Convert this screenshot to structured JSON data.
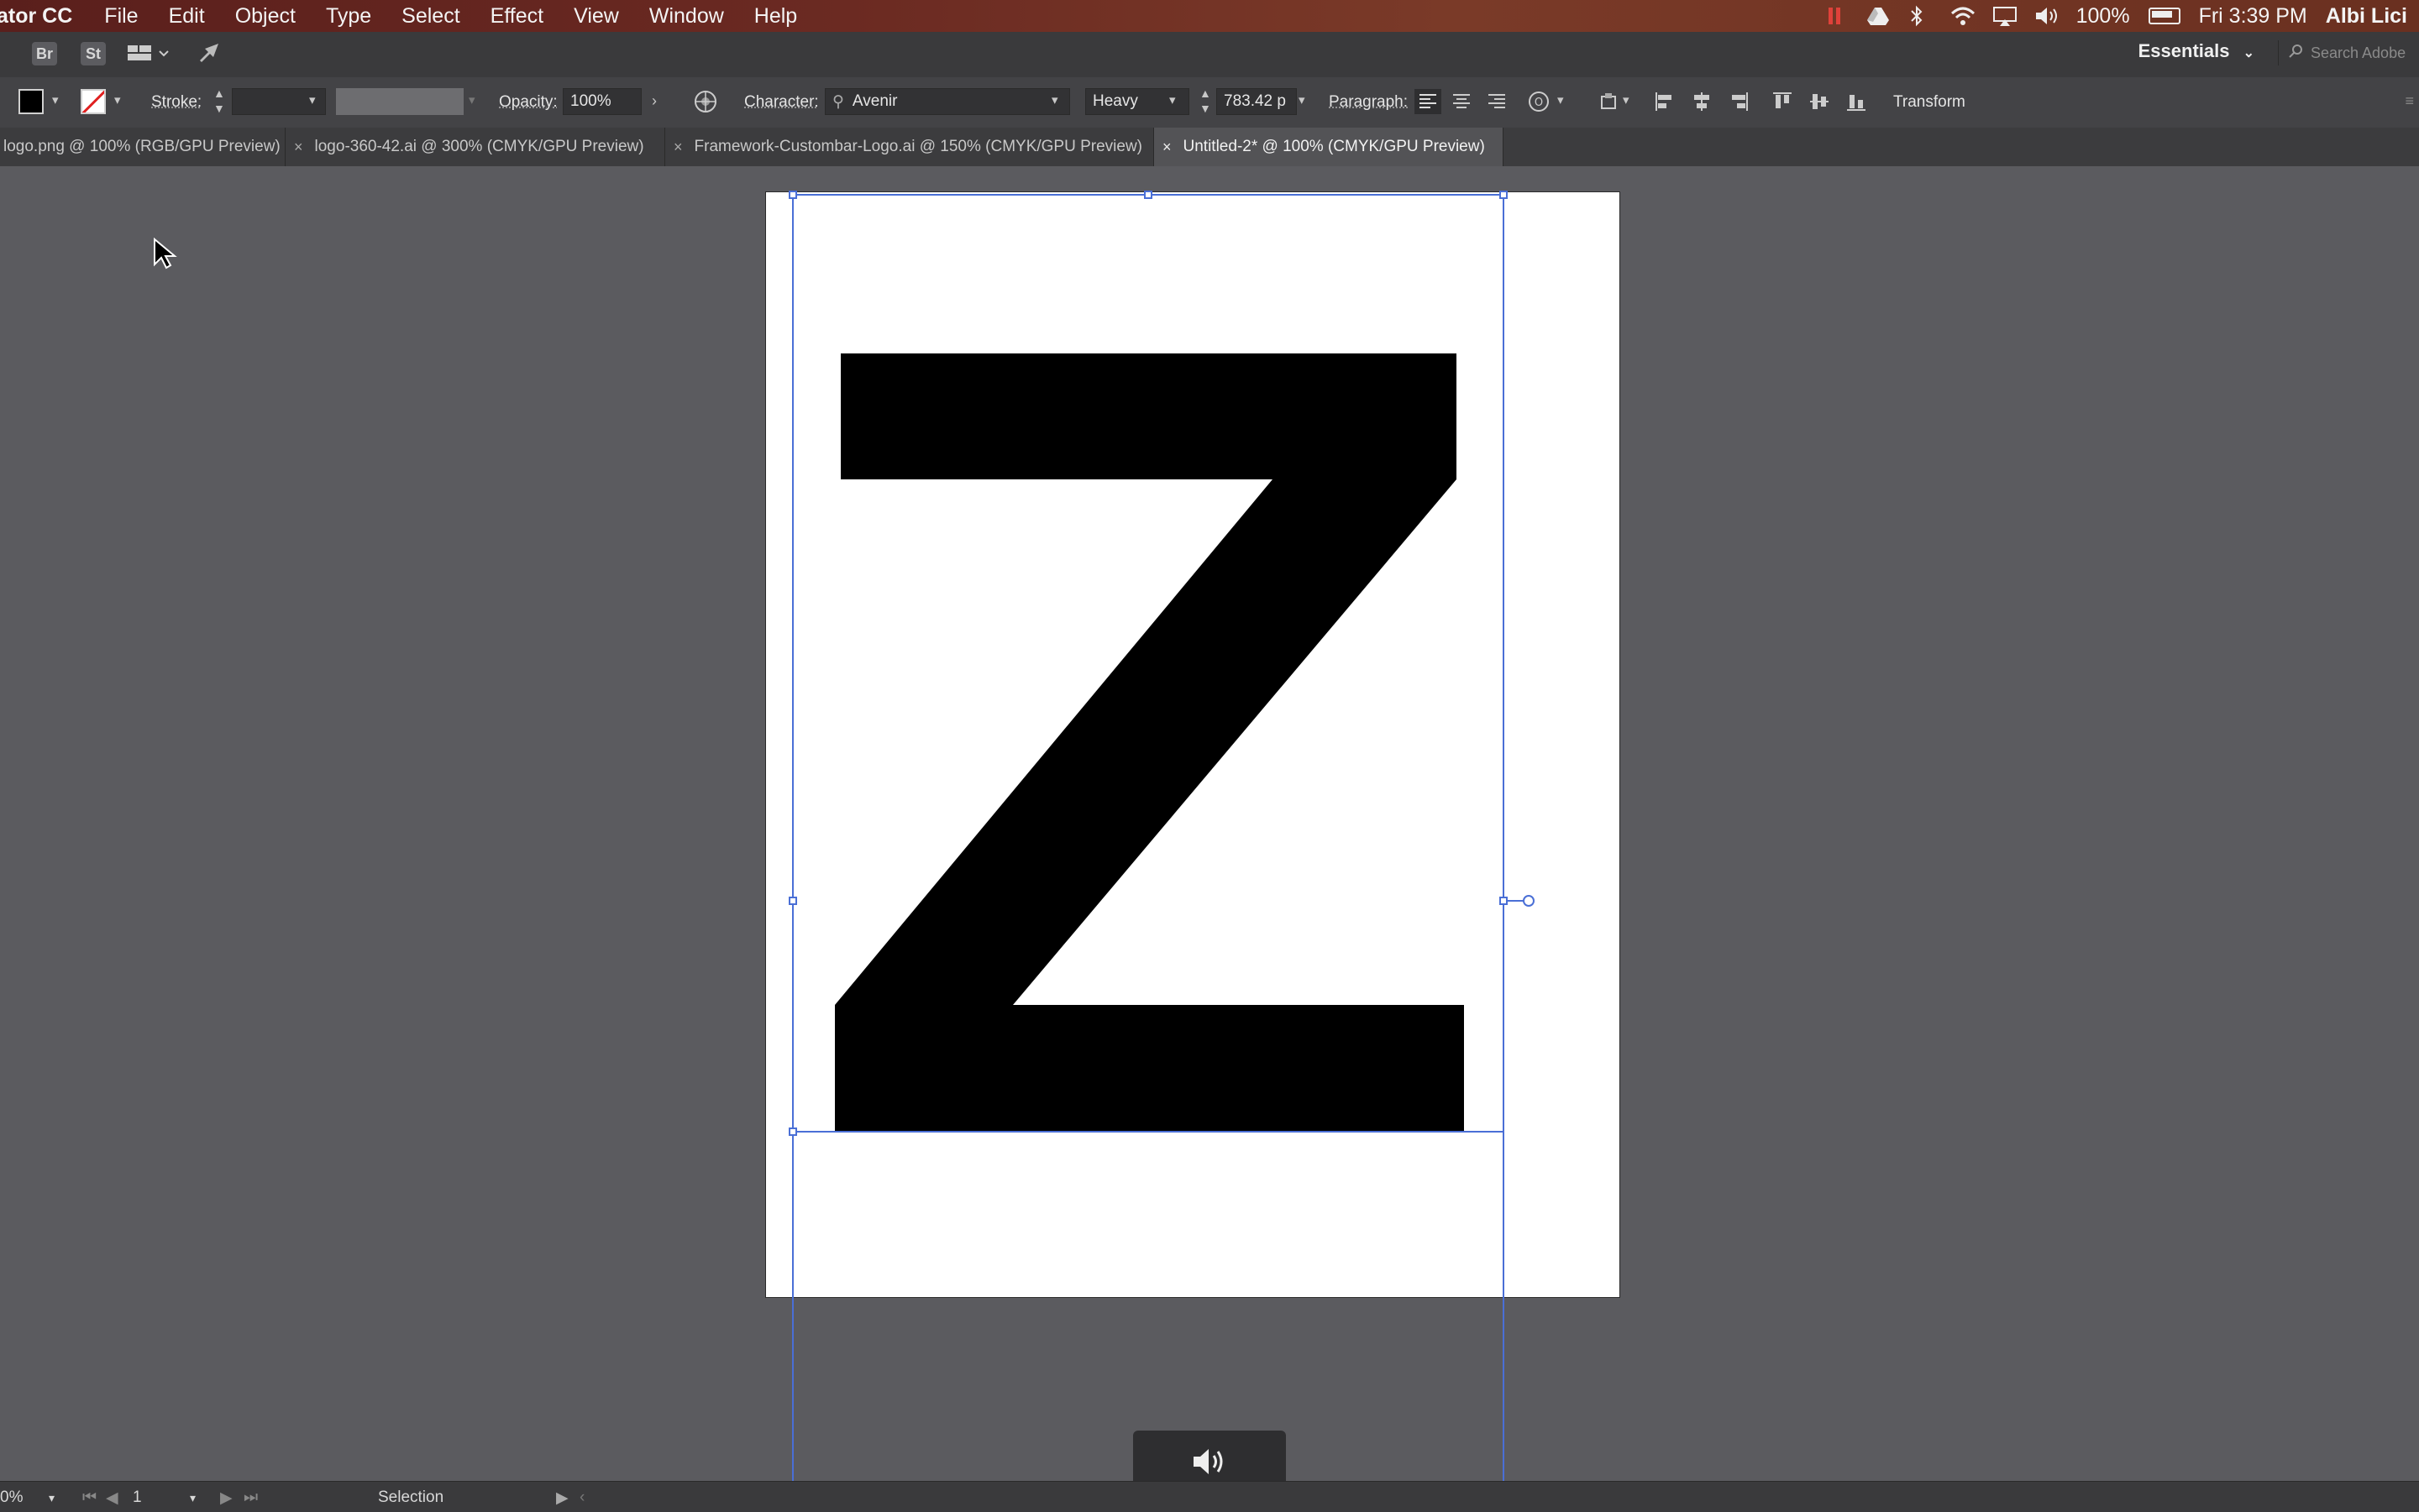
{
  "menubar": {
    "app_name": "ator CC",
    "items": [
      "File",
      "Edit",
      "Object",
      "Type",
      "Select",
      "Effect",
      "View",
      "Window",
      "Help"
    ],
    "battery": "100%",
    "clock": "Fri 3:39 PM",
    "user": "Albi Lici"
  },
  "appbar": {
    "bridge": "Br",
    "stock": "St",
    "workspace": "Essentials",
    "search_placeholder": "Search Adobe"
  },
  "controlbar": {
    "stroke_label": "Stroke:",
    "opacity_label": "Opacity:",
    "opacity_value": "100%",
    "character_label": "Character:",
    "font_family": "Avenir",
    "font_style": "Heavy",
    "font_size": "783.42 p",
    "paragraph_label": "Paragraph:",
    "transform_label": "Transform"
  },
  "tabs": [
    {
      "label": "logo.png @ 100% (RGB/GPU Preview)",
      "active": false
    },
    {
      "label": "logo-360-42.ai @ 300% (CMYK/GPU Preview)",
      "active": false
    },
    {
      "label": "Framework-Custombar-Logo.ai @ 150% (CMYK/GPU Preview)",
      "active": false
    },
    {
      "label": "Untitled-2* @ 100% (CMYK/GPU Preview)",
      "active": true
    }
  ],
  "artboard": {
    "glyph": "Z",
    "fill_color": "#000000"
  },
  "statusbar": {
    "zoom": "0%",
    "artboard_number": "1",
    "tool": "Selection"
  },
  "colors": {
    "selection": "#4a6fd6",
    "menubar_accent": "#6b2a22",
    "recording_indicator": "#e0413a"
  }
}
